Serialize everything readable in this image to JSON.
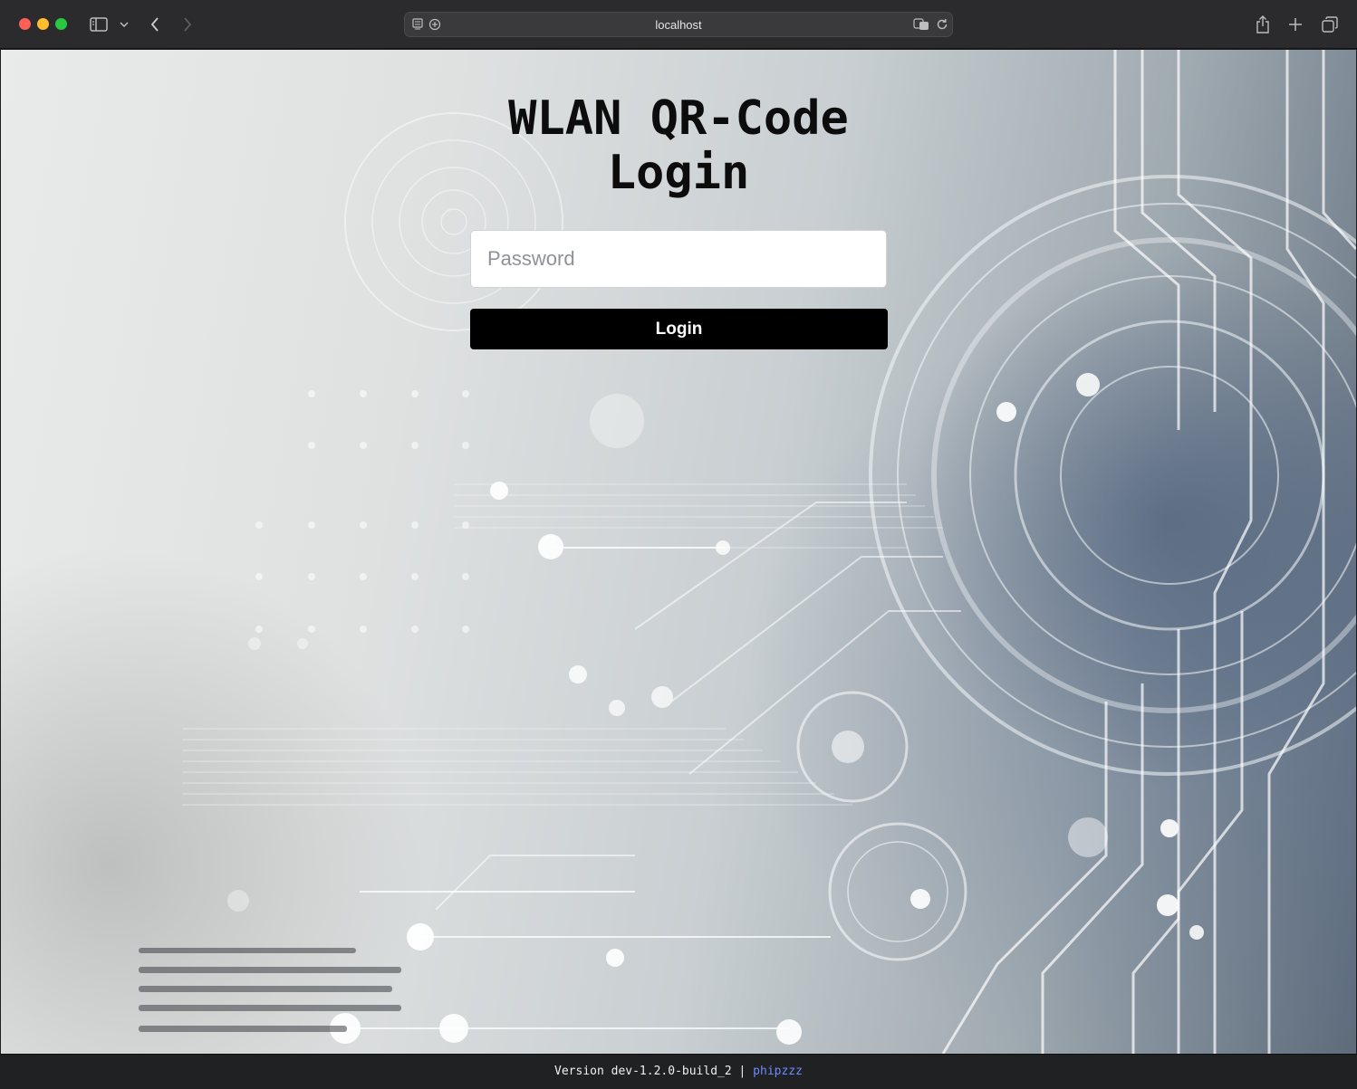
{
  "browser": {
    "url": "localhost",
    "icons": {
      "sidebar": "sidebar-icon",
      "chevron": "chevron-down-icon",
      "back": "back-arrow-icon",
      "forward": "forward-arrow-icon",
      "reader": "reader-icon",
      "privacy": "privacy-icon",
      "translate": "translate-icon",
      "reload": "reload-icon",
      "share": "share-icon",
      "new_tab": "plus-icon",
      "tabs": "tab-overview-icon"
    }
  },
  "login": {
    "title_line1": "WLAN QR-Code",
    "title_line2": "Login",
    "password_placeholder": "Password",
    "login_label": "Login"
  },
  "footer": {
    "version_text": "Version dev-1.2.0-build_2",
    "separator": " | ",
    "author_link": "phipzzz"
  },
  "colors": {
    "button_bg": "#000000",
    "link": "#6d8cff",
    "footer_bg": "#1f2123"
  }
}
